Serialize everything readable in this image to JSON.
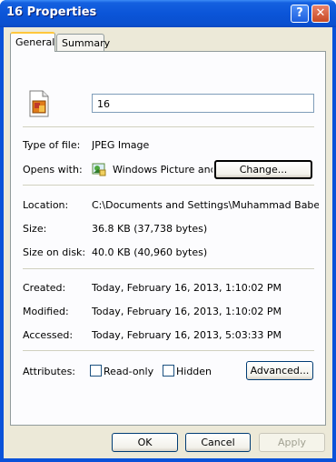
{
  "window": {
    "title": "16 Properties"
  },
  "tabs": [
    {
      "label": "General"
    },
    {
      "label": "Summary"
    }
  ],
  "general": {
    "file_name": "16",
    "type_label": "Type of file:",
    "type_value": "JPEG Image",
    "opens_label": "Opens with:",
    "opens_value": "Windows Picture and F",
    "change_label": "Change...",
    "location_label": "Location:",
    "location_value": "C:\\Documents and Settings\\Muhammad Baber Zam",
    "size_label": "Size:",
    "size_value": "36.8 KB (37,738 bytes)",
    "size_on_disk_label": "Size on disk:",
    "size_on_disk_value": "40.0 KB (40,960 bytes)",
    "created_label": "Created:",
    "created_value": "Today, February 16, 2013, 1:10:02 PM",
    "modified_label": "Modified:",
    "modified_value": "Today, February 16, 2013, 1:10:02 PM",
    "accessed_label": "Accessed:",
    "accessed_value": "Today, February 16, 2013, 5:03:33 PM",
    "attributes_label": "Attributes:",
    "readonly_label": "Read-only",
    "readonly_checked": false,
    "hidden_label": "Hidden",
    "hidden_checked": false,
    "advanced_label": "Advanced..."
  },
  "footer": {
    "ok_label": "OK",
    "cancel_label": "Cancel",
    "apply_label": "Apply"
  },
  "icons": {
    "file": "jpeg-file-icon",
    "app": "picture-viewer-icon",
    "help": "help-icon",
    "close": "close-icon"
  },
  "colors": {
    "titlebar": "#0a52d9",
    "dialog_bg": "#ece9d8",
    "tab_highlight": "#ffc73c"
  }
}
